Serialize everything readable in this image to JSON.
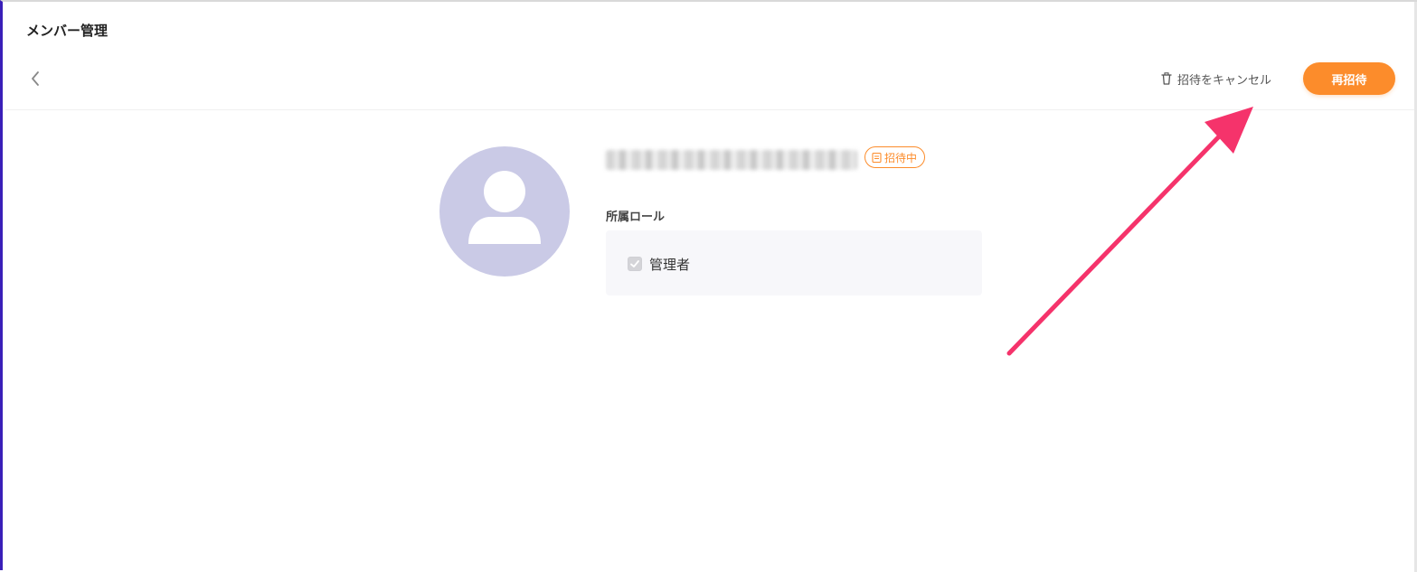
{
  "header": {
    "title": "メンバー管理"
  },
  "toolbar": {
    "back_icon": "chevron-left-icon",
    "cancel_invite_label": "招待をキャンセル",
    "cancel_invite_icon": "trash-icon",
    "reinvite_label": "再招待"
  },
  "member": {
    "avatar_icon": "user-silhouette-icon",
    "status_badge": "招待中",
    "status_icon": "clipboard-icon",
    "roles_heading": "所属ロール",
    "roles": [
      {
        "label": "管理者",
        "checked": true
      }
    ]
  },
  "colors": {
    "accent": "#fc8c2b",
    "avatar_bg": "#cacae6",
    "annotation_arrow": "#f5336b",
    "frame_border": "#3a1fb8"
  }
}
